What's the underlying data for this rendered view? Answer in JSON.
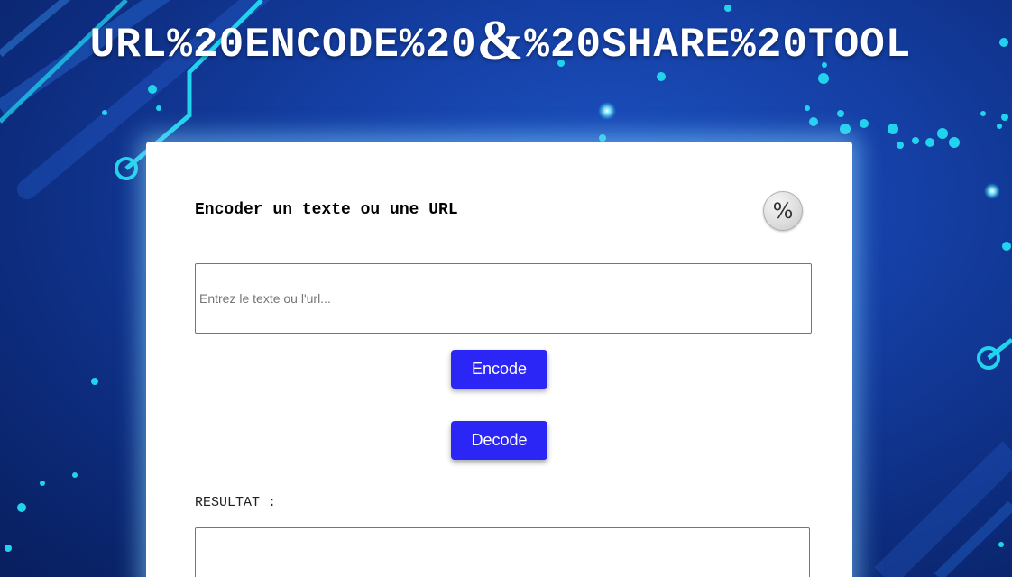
{
  "header": {
    "title_before": "URL%20ENCODE%20",
    "title_amp": "&",
    "title_after": "%20SHARE%20TOOL"
  },
  "panel": {
    "heading": "Encoder un texte ou une URL",
    "percent_button_label": "%",
    "input": {
      "placeholder": "Entrez le texte ou l'url...",
      "value": ""
    },
    "encode_label": "Encode",
    "decode_label": "Decode",
    "result_label": "RESULTAT :",
    "result_value": ""
  },
  "colors": {
    "background": "#1540a6",
    "circuit": "#22d3ee",
    "button": "#2b26f5",
    "panel": "#ffffff"
  }
}
